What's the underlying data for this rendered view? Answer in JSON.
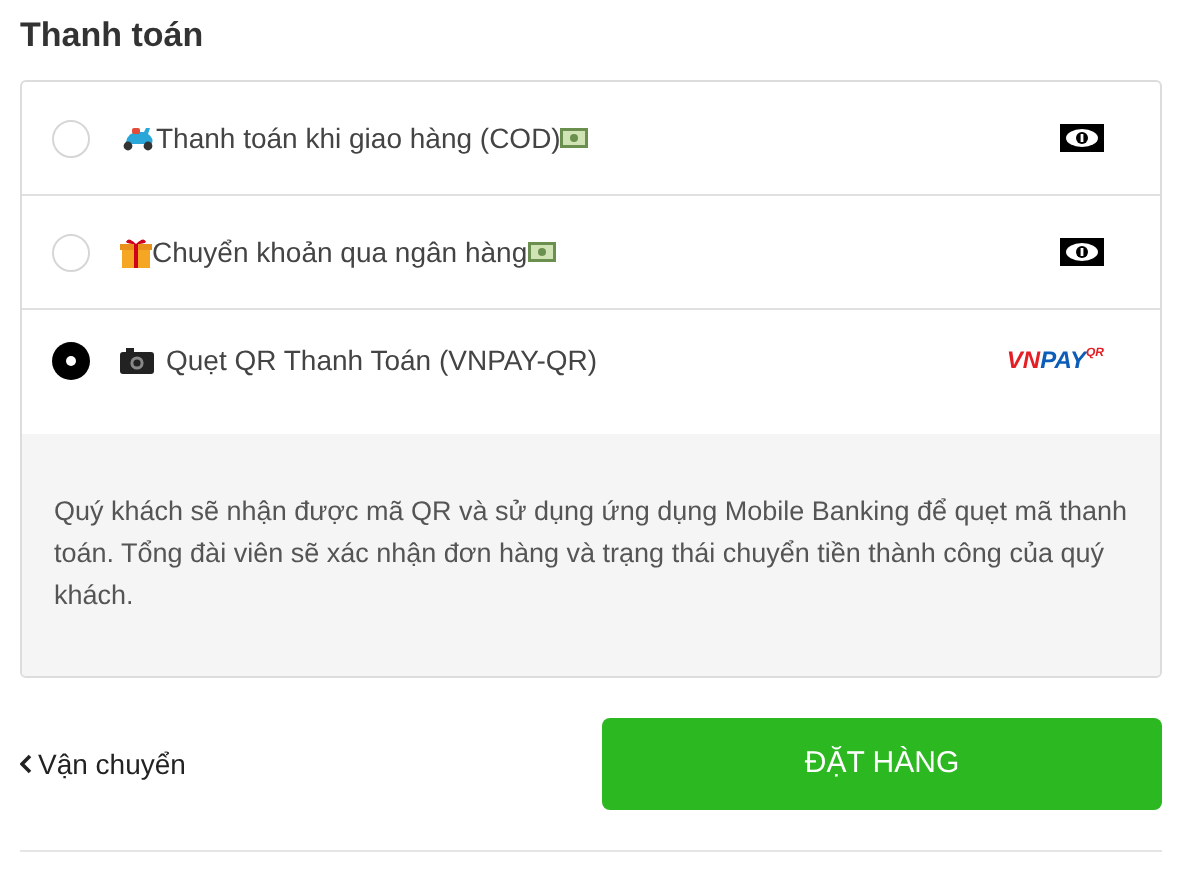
{
  "title": "Thanh toán",
  "options": [
    {
      "kind": "delivery",
      "label": "Thanh toán khi giao hàng (COD)",
      "selected": false
    },
    {
      "kind": "transfer",
      "label": "Chuyển khoản qua ngân hàng",
      "selected": false
    },
    {
      "kind": "qr",
      "label": "Quẹt QR Thanh Toán (VNPAY-QR)",
      "selected": true,
      "logo": {
        "main": "VNPAY",
        "sup": "QR"
      }
    }
  ],
  "description": "Quý khách sẽ nhận được mã QR và sử dụng ứng dụng Mobile Banking để quẹt mã thanh toán. Tổng đài viên sẽ xác nhận đơn hàng và trạng thái chuyển tiền thành công của quý khách.",
  "back_link": "Vận chuyển",
  "submit_button": "ĐẶT HÀNG"
}
